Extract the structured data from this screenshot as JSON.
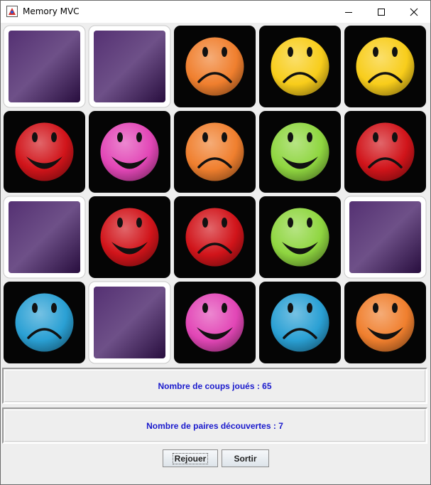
{
  "window": {
    "title": "Memory MVC"
  },
  "board": {
    "rows": 4,
    "cols": 5,
    "cards": [
      {
        "state": "hidden"
      },
      {
        "state": "hidden"
      },
      {
        "state": "face",
        "color": "#f07f2e",
        "mood": "sad"
      },
      {
        "state": "face",
        "color": "#f8cd1b",
        "mood": "sad"
      },
      {
        "state": "face",
        "color": "#f8cd1b",
        "mood": "sad"
      },
      {
        "state": "face",
        "color": "#d1141a",
        "mood": "happy"
      },
      {
        "state": "face",
        "color": "#e246b6",
        "mood": "happy"
      },
      {
        "state": "face",
        "color": "#f07f2e",
        "mood": "sad"
      },
      {
        "state": "face",
        "color": "#8fd640",
        "mood": "happy"
      },
      {
        "state": "face",
        "color": "#d1141a",
        "mood": "sad"
      },
      {
        "state": "hidden"
      },
      {
        "state": "face",
        "color": "#d1141a",
        "mood": "happy"
      },
      {
        "state": "face",
        "color": "#d1141a",
        "mood": "sad"
      },
      {
        "state": "face",
        "color": "#8fd640",
        "mood": "happy"
      },
      {
        "state": "hidden"
      },
      {
        "state": "face",
        "color": "#2aa0d4",
        "mood": "sad"
      },
      {
        "state": "hidden"
      },
      {
        "state": "face",
        "color": "#e246b6",
        "mood": "happy"
      },
      {
        "state": "face",
        "color": "#2aa0d4",
        "mood": "sad"
      },
      {
        "state": "face",
        "color": "#f07f2e",
        "mood": "happy"
      }
    ]
  },
  "stats": {
    "moves_text": "Nombre de coups joués : 65",
    "pairs_text": "Nombre de paires découvertes : 7"
  },
  "buttons": {
    "replay_label": "Rejouer",
    "quit_label": "Sortir"
  },
  "colors": {
    "text_accent": "#1a1acd",
    "card_back": "#3e1560"
  }
}
